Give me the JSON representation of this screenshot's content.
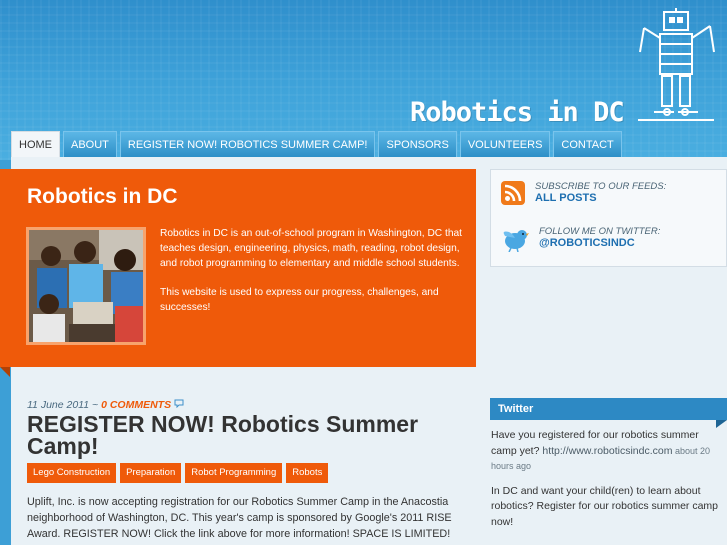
{
  "site": {
    "logo_text": "Robotics in DC"
  },
  "nav": {
    "items": [
      {
        "label": "Home",
        "active": true
      },
      {
        "label": "About"
      },
      {
        "label": "Register Now! Robotics Summer Camp!"
      },
      {
        "label": "Sponsors"
      },
      {
        "label": "Volunteers"
      },
      {
        "label": "Contact"
      }
    ]
  },
  "featured": {
    "title": "Robotics in DC",
    "paragraph1": "Robotics in DC is an out-of-school program in Washington, DC that teaches design, engineering, physics, math, reading, robot design, and robot programming to elementary and middle school students.",
    "paragraph2": "This website is used to express our progress, challenges, and successes!"
  },
  "sidebar": {
    "subscribe_label": "Subscribe to our feeds:",
    "subscribe_link": "All Posts",
    "follow_label": "Follow me on Twitter:",
    "follow_link": "@roboticsindc",
    "twitter_heading": "Twitter",
    "tweets": [
      {
        "text": "Have you registered for our robotics summer camp yet? ",
        "link": "http://www.roboticsindc.com",
        "time": " about 20 hours ago"
      },
      {
        "text": "In DC and want your child(ren) to learn about robotics? Register for our robotics summer camp now!",
        "link": "",
        "time": ""
      }
    ]
  },
  "post": {
    "date": "11 June 2011 ~ ",
    "comments": "0 Comments",
    "title": "REGISTER NOW! Robotics Summer Camp!",
    "tags": [
      "Lego Construction",
      "Preparation",
      "Robot Programming",
      "Robots"
    ],
    "body": "Uplift, Inc. is now accepting registration for our Robotics Summer Camp in the Anacostia neighborhood of Washington, DC.  This year's camp is sponsored by Google's 2011 RISE Award. REGISTER NOW! Click the link above for more information! SPACE IS LIMITED!"
  },
  "icons": {
    "rss": "rss-feed-icon",
    "twitter": "twitter-bird-icon",
    "comment": "comment-bubble-icon",
    "robot": "robot-logo-icon"
  },
  "colors": {
    "accent_orange": "#ef5a0a",
    "sky_blue": "#3d9fd6",
    "link_blue": "#1e6fb0"
  }
}
